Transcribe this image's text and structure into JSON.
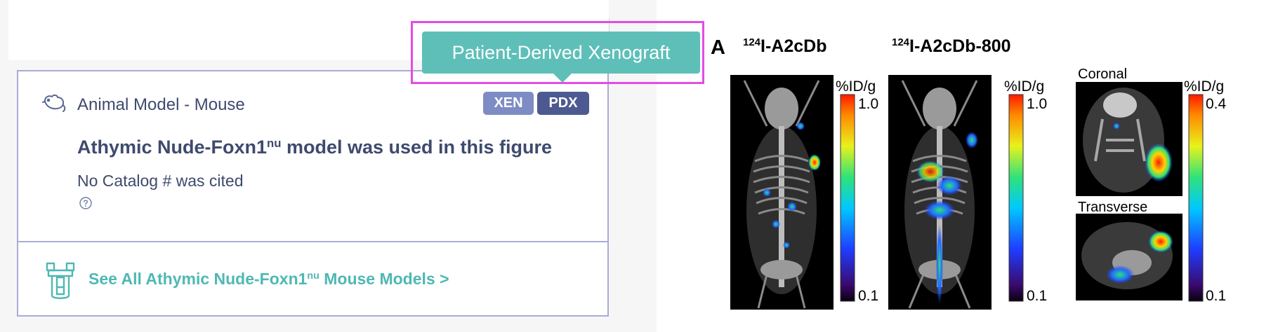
{
  "card": {
    "model_label": "Animal Model - Mouse",
    "badges": [
      "XEN",
      "PDX"
    ],
    "headline_prefix": "Athymic Nude-Foxn1",
    "headline_sup": "nu",
    "headline_suffix": " model was used in this figure",
    "catalog_text": "No Catalog # was cited",
    "link_prefix": "See All Athymic Nude-Foxn1",
    "link_sup": "nu",
    "link_suffix": " Mouse Models >"
  },
  "tooltip": {
    "text": "Patient-Derived Xenograft"
  },
  "figure": {
    "panel_letter": "A",
    "panel1_title_sup": "124",
    "panel1_title": "I-A2cDb",
    "panel2_title_sup": "124",
    "panel2_title": "I-A2cDb-800",
    "unit_label": "%ID/g",
    "scale1_max": "1.0",
    "scale1_min": "0.1",
    "scale2_max": "1.0",
    "scale2_min": "0.1",
    "scale3_max": "0.4",
    "scale3_min": "0.1",
    "coronal_label": "Coronal",
    "transverse_label": "Transverse"
  },
  "colors": {
    "navy_text": "#3e4a6e",
    "teal": "#4fb8b3",
    "tooltip_bg": "#5ebfb9",
    "badge_light": "#7d8cc4",
    "badge_dark": "#4c5a91",
    "highlight_frame": "#e44be6",
    "card_border": "#a9abd6"
  },
  "icons": [
    "mouse-icon",
    "help-circle-icon",
    "test-tube-icon"
  ]
}
